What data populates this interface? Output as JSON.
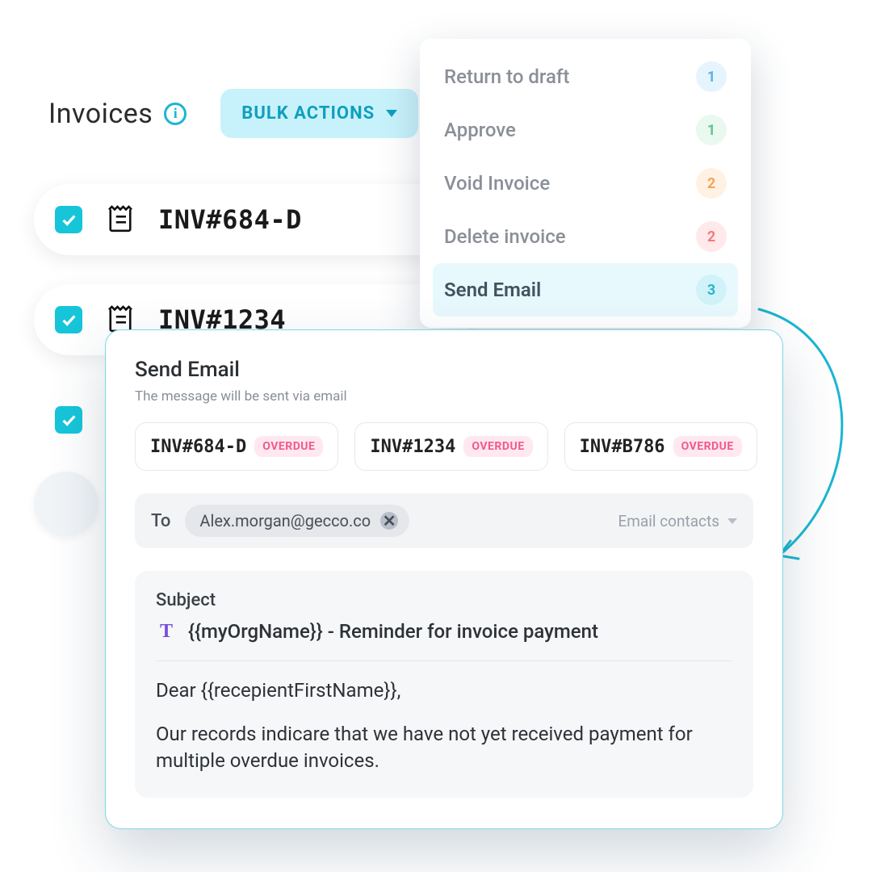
{
  "header": {
    "title": "Invoices",
    "bulk_label": "BULK ACTIONS"
  },
  "menu": {
    "items": [
      {
        "label": "Return to draft",
        "badge": "1",
        "color": "b-blue"
      },
      {
        "label": "Approve",
        "badge": "1",
        "color": "b-green"
      },
      {
        "label": "Void Invoice",
        "badge": "2",
        "color": "b-orange"
      },
      {
        "label": "Delete invoice",
        "badge": "2",
        "color": "b-pink"
      },
      {
        "label": "Send Email",
        "badge": "3",
        "color": "b-teal",
        "selected": true
      }
    ]
  },
  "list": {
    "rows": [
      {
        "id": "INV#684-D"
      },
      {
        "id": "INV#1234"
      }
    ]
  },
  "modal": {
    "title": "Send Email",
    "sub": "The message will be sent via email",
    "chips": [
      {
        "id": "INV#684-D",
        "status": "OVERDUE"
      },
      {
        "id": "INV#1234",
        "status": "OVERDUE"
      },
      {
        "id": "INV#B786",
        "status": "OVERDUE"
      }
    ],
    "to_label": "To",
    "to_email": "Alex.morgan@gecco.co",
    "contacts_label": "Email contacts",
    "subject_label": "Subject",
    "subject_value": "{{myOrgName}} - Reminder for invoice payment",
    "body_line1": "Dear {{recepientFirstName}},",
    "body_line2": "Our records indicare that we have not yet received payment for multiple overdue invoices."
  }
}
